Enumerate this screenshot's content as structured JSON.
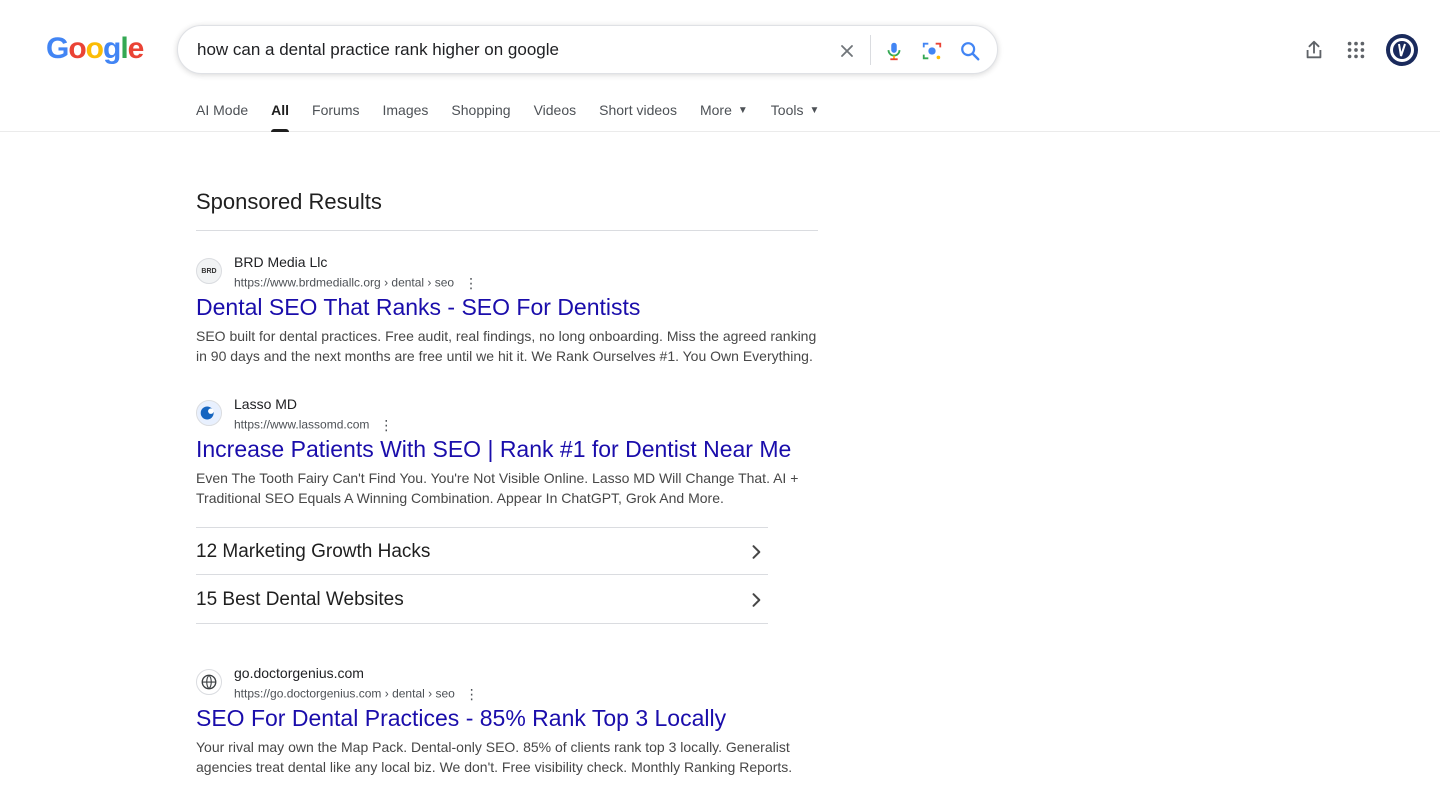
{
  "search": {
    "query": "how can a dental practice rank higher on google"
  },
  "logo": {
    "letters": [
      "G",
      "o",
      "o",
      "g",
      "l",
      "e"
    ],
    "colors": [
      "#4285F4",
      "#EA4335",
      "#FBBC05",
      "#4285F4",
      "#34A853",
      "#EA4335"
    ]
  },
  "tabs": [
    {
      "label": "AI Mode"
    },
    {
      "label": "All"
    },
    {
      "label": "Forums"
    },
    {
      "label": "Images"
    },
    {
      "label": "Shopping"
    },
    {
      "label": "Videos"
    },
    {
      "label": "Short videos"
    },
    {
      "label": "More"
    },
    {
      "label": "Tools"
    }
  ],
  "sponsored_heading": "Sponsored Results",
  "ads": [
    {
      "advertiser": "BRD Media Llc",
      "url": "https://www.brdmediallc.org",
      "breadcrumb": " › dental › seo",
      "favicon_text": "BRD",
      "title": "Dental SEO That Ranks - SEO For Dentists",
      "description": "SEO built for dental practices. Free audit, real findings, no long onboarding. Miss the agreed ranking in 90 days and the next months are free until we hit it. We Rank Ourselves #1. You Own Everything."
    },
    {
      "advertiser": "Lasso MD",
      "url": "https://www.lassomd.com",
      "breadcrumb": "",
      "favicon_text": "",
      "title": "Increase Patients With SEO | Rank #1 for Dentist Near Me",
      "description": "Even The Tooth Fairy Can't Find You. You're Not Visible Online. Lasso MD Will Change That. AI + Traditional SEO Equals A Winning Combination. Appear In ChatGPT, Grok And More."
    },
    {
      "advertiser": "go.doctorgenius.com",
      "url": "https://go.doctorgenius.com",
      "breadcrumb": " › dental › seo",
      "favicon_text": "",
      "title": "SEO For Dental Practices - 85% Rank Top 3 Locally",
      "description": "Your rival may own the Map Pack. Dental-only SEO. 85% of clients rank top 3 locally. Generalist agencies treat dental like any local biz. We don't. Free visibility check. Monthly Ranking Reports."
    }
  ],
  "sitelinks": [
    {
      "label": "12 Marketing Growth Hacks"
    },
    {
      "label": "15 Best Dental Websites"
    }
  ],
  "colors": {
    "link_title": "#1a0dab",
    "accent_blue": "#4285F4"
  }
}
